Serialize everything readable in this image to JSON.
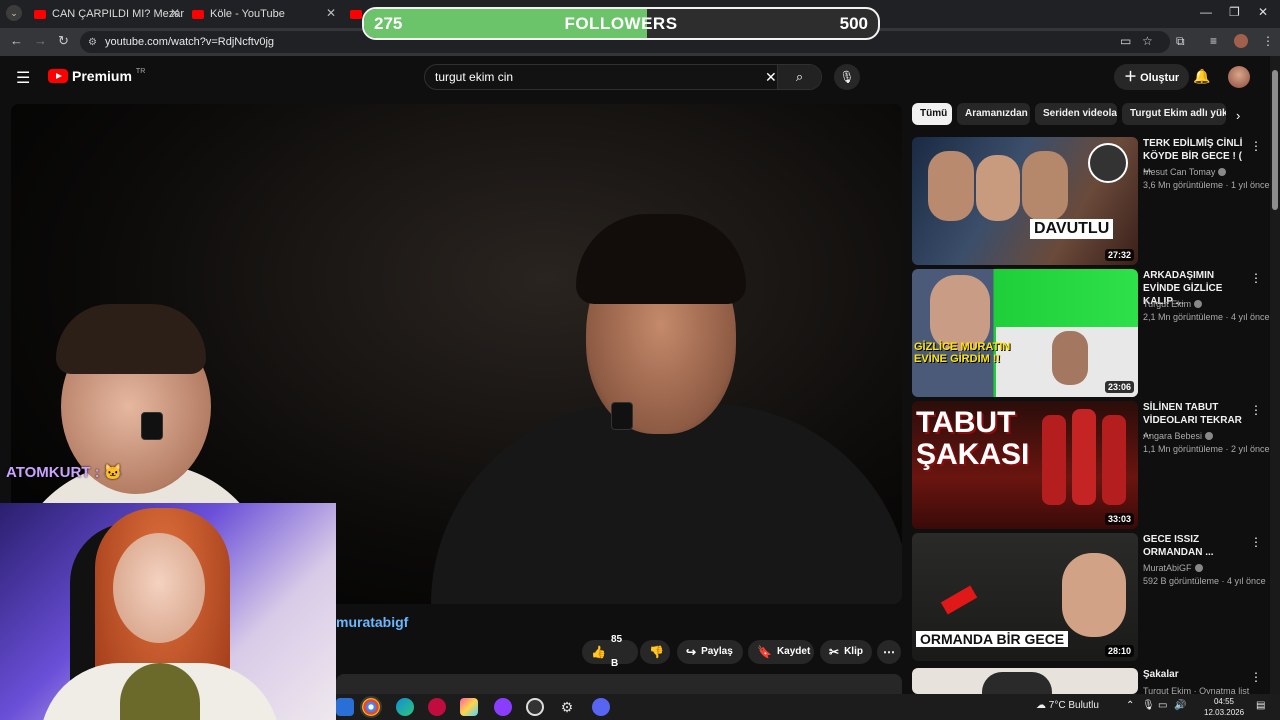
{
  "browser": {
    "tabs": [
      {
        "title": "CAN ÇARPILDI MI? Mezarlık Bel",
        "active": false
      },
      {
        "title": "Köle - YouTube",
        "active": false
      },
      {
        "title": "",
        "active": true
      }
    ],
    "url": "youtube.com/watch?v=RdjNcftv0jg"
  },
  "followers_widget": {
    "current": "275",
    "label": "FOLLOWERS",
    "goal": "500",
    "progress": 0.55,
    "colors": {
      "fill": "#6cc46a",
      "border": "#f2f2f2"
    }
  },
  "youtube": {
    "brand": "Premium",
    "region": "TR",
    "search_query": "turgut ekim cin",
    "create_label": "Oluştur"
  },
  "video": {
    "channel": "muratabigf",
    "like_count": "85 B",
    "share_label": "Paylaş",
    "save_label": "Kaydet",
    "clip_label": "Klip"
  },
  "stream_chat": {
    "message": "ATOMKURT : 🐱"
  },
  "chips": [
    "Tümü",
    "Aramanızdan",
    "Seriden videolar",
    "Turgut Ekim adlı yükle"
  ],
  "recommendations": [
    {
      "title": "TERK EDİLMİŞ CİNLİ KÖYDE BİR GECE ! ( ...",
      "channel": "Mesut Can Tomay",
      "meta": "3,6 Mn görüntüleme · 1 yıl önce",
      "duration": "27:32",
      "overlay": "DAVUTLU"
    },
    {
      "title": "ARKADAŞIMIN EVİNDE GİZLİCE KALIP ...",
      "channel": "Turgut Ekim",
      "meta": "2,1 Mn görüntüleme · 4 yıl önce",
      "duration": "23:06",
      "overlay": "GİZLİCE MURATIN EVİNE GİRDİM !!"
    },
    {
      "title": "SİLİNEN TABUT VİDEOLARI TEKRAR ...",
      "channel": "Angara Bebesi",
      "meta": "1,1 Mn görüntüleme · 2 yıl önce",
      "duration": "33:03",
      "overlay": "TABUT ŞAKASI"
    },
    {
      "title": "GECE ISSIZ ORMANDAN ...",
      "channel": "MuratAbiGF",
      "meta": "592 B görüntüleme · 4 yıl önce",
      "duration": "28:10",
      "overlay": "ORMANDA BİR GECE"
    },
    {
      "title": "Şakalar",
      "channel": "Turgut Ekim · Oynatma list",
      "meta": "",
      "duration": "",
      "overlay": ""
    }
  ],
  "taskbar": {
    "weather": "7°C  Bulutlu",
    "time": "04:55",
    "date": "12.03.2026"
  }
}
